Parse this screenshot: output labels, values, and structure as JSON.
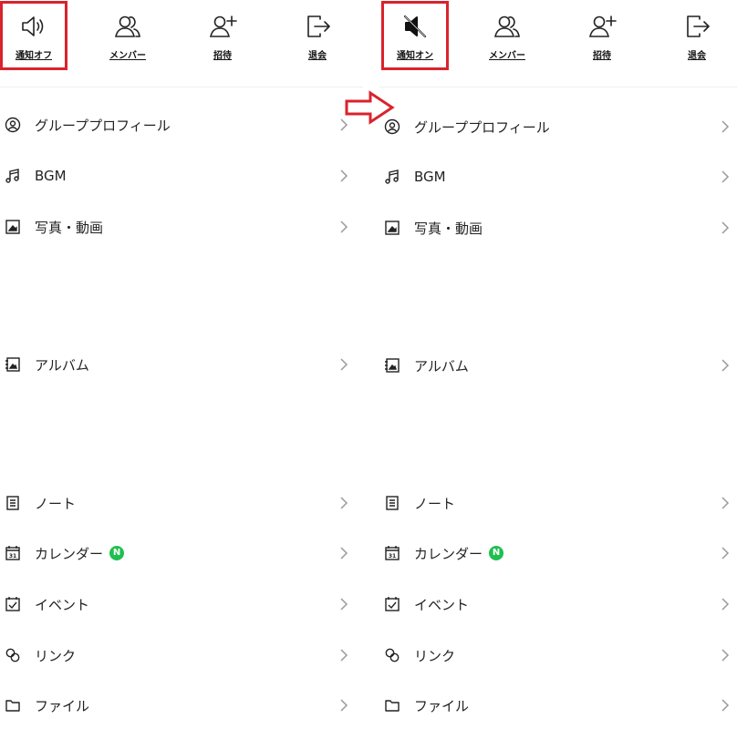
{
  "left": {
    "toolbar": [
      {
        "label": "通知オフ",
        "icon": "speaker-icon"
      },
      {
        "label": "メンバー",
        "icon": "members-icon"
      },
      {
        "label": "招待",
        "icon": "add-user-icon"
      },
      {
        "label": "退会",
        "icon": "leave-icon"
      }
    ],
    "menu": [
      {
        "label": "グループプロフィール",
        "icon": "profile-icon"
      },
      {
        "label": "BGM",
        "icon": "music-note-icon"
      },
      {
        "label": "写真・動画",
        "icon": "photo-icon"
      },
      {
        "label": "アルバム",
        "icon": "album-icon"
      },
      {
        "label": "ノート",
        "icon": "note-icon"
      },
      {
        "label": "カレンダー",
        "icon": "calendar-icon",
        "badge": "N"
      },
      {
        "label": "イベント",
        "icon": "event-icon"
      },
      {
        "label": "リンク",
        "icon": "link-icon"
      },
      {
        "label": "ファイル",
        "icon": "folder-icon"
      }
    ]
  },
  "right": {
    "toolbar": [
      {
        "label": "通知オン",
        "icon": "speaker-muted-icon"
      },
      {
        "label": "メンバー",
        "icon": "members-icon"
      },
      {
        "label": "招待",
        "icon": "add-user-icon"
      },
      {
        "label": "退会",
        "icon": "leave-icon"
      }
    ],
    "menu": [
      {
        "label": "グループプロフィール",
        "icon": "profile-icon"
      },
      {
        "label": "BGM",
        "icon": "music-note-icon"
      },
      {
        "label": "写真・動画",
        "icon": "photo-icon"
      },
      {
        "label": "アルバム",
        "icon": "album-icon"
      },
      {
        "label": "ノート",
        "icon": "note-icon"
      },
      {
        "label": "カレンダー",
        "icon": "calendar-icon",
        "badge": "N"
      },
      {
        "label": "イベント",
        "icon": "event-icon"
      },
      {
        "label": "リンク",
        "icon": "link-icon"
      },
      {
        "label": "ファイル",
        "icon": "folder-icon"
      }
    ]
  },
  "colors": {
    "highlight": "#d9232d",
    "badge": "#1fbf4f",
    "arrow": "#d9232d"
  },
  "annotation": {
    "icon": "right-arrow-icon"
  }
}
